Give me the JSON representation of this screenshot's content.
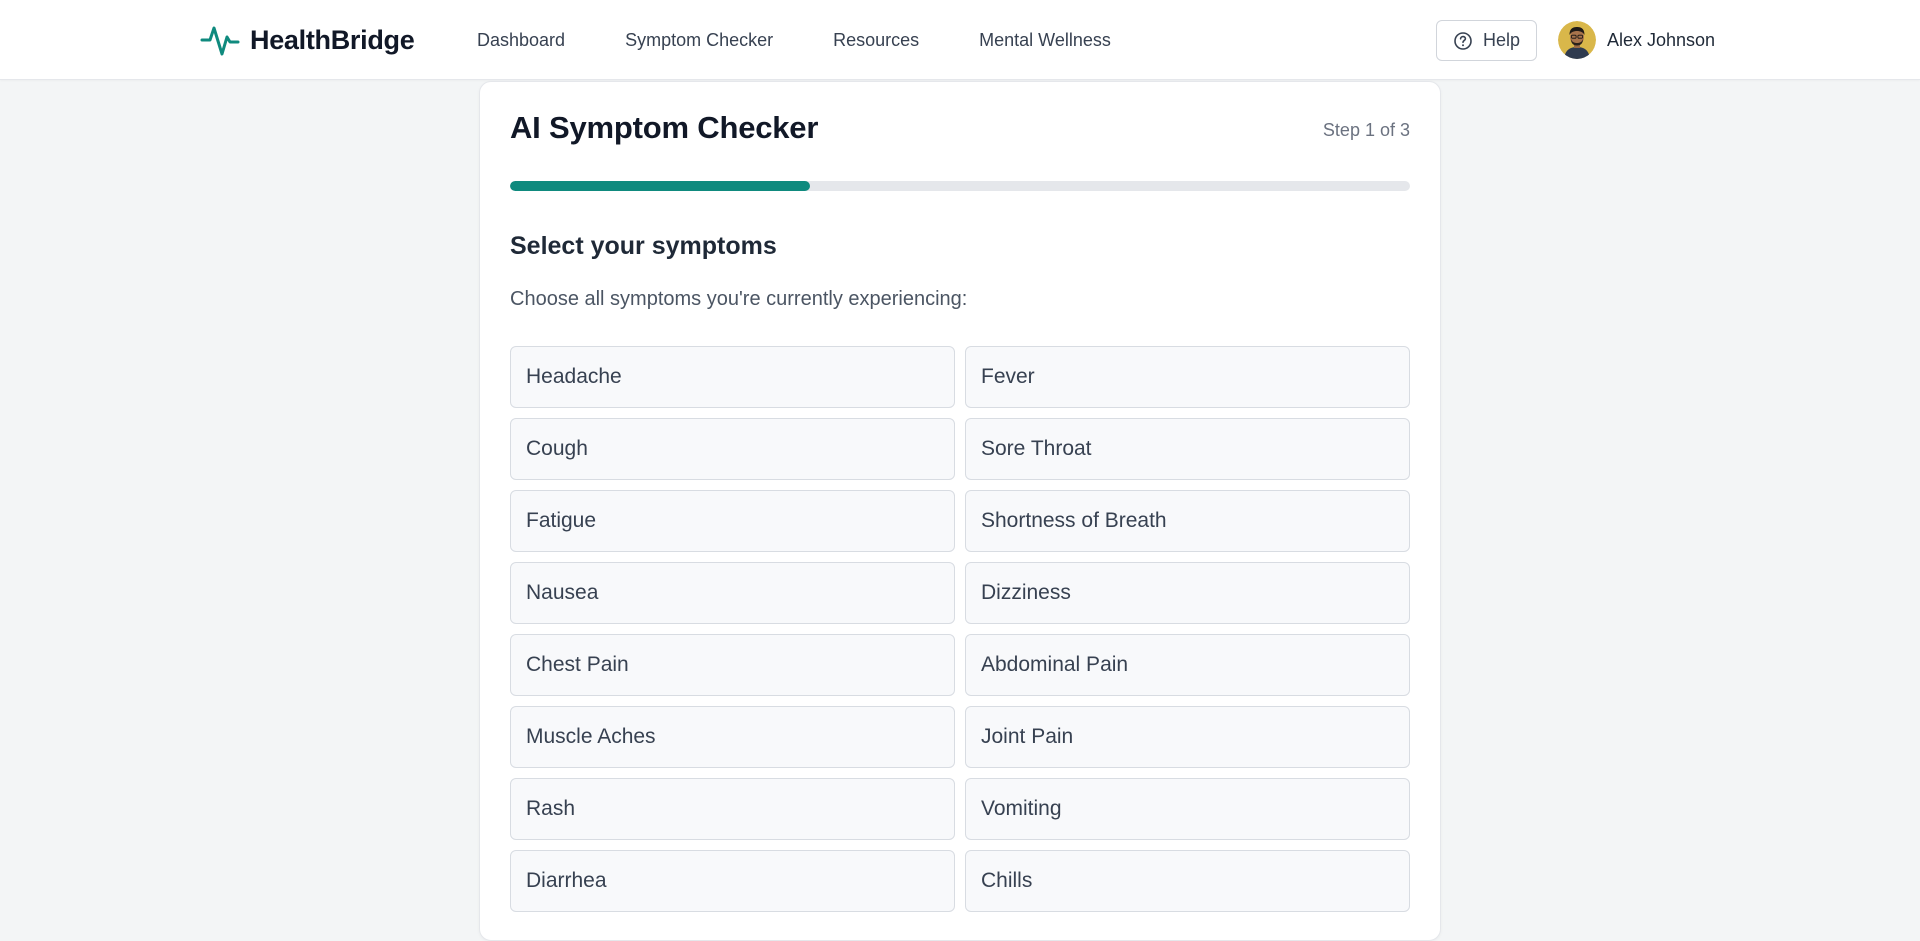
{
  "header": {
    "brand": "HealthBridge",
    "nav": [
      "Dashboard",
      "Symptom Checker",
      "Resources",
      "Mental Wellness"
    ],
    "help_label": "Help",
    "user_name": "Alex Johnson"
  },
  "checker": {
    "title": "AI Symptom Checker",
    "step": "Step 1 of 3",
    "progress": 0.333,
    "section_title": "Select your symptoms",
    "instruction": "Choose all symptoms you're currently experiencing:",
    "symptoms": [
      "Headache",
      "Fever",
      "Cough",
      "Sore Throat",
      "Fatigue",
      "Shortness of Breath",
      "Nausea",
      "Dizziness",
      "Chest Pain",
      "Abdominal Pain",
      "Muscle Aches",
      "Joint Pain",
      "Rash",
      "Vomiting",
      "Diarrhea",
      "Chills"
    ]
  },
  "colors": {
    "accent": "#0f8a7e",
    "page_background": "#f3f5f6",
    "progress_track": "#e5e7eb"
  },
  "icons": {
    "brand": "pulse-icon",
    "help": "question-circle-icon",
    "avatar": "user-avatar"
  }
}
